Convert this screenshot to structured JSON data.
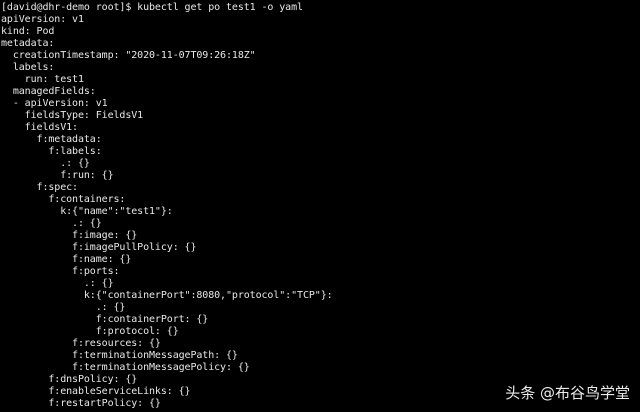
{
  "terminal": {
    "lines": [
      "[david@dhr-demo root]$ kubectl get po test1 -o yaml",
      "apiVersion: v1",
      "kind: Pod",
      "metadata:",
      "  creationTimestamp: \"2020-11-07T09:26:18Z\"",
      "  labels:",
      "    run: test1",
      "  managedFields:",
      "  - apiVersion: v1",
      "    fieldsType: FieldsV1",
      "    fieldsV1:",
      "      f:metadata:",
      "        f:labels:",
      "          .: {}",
      "          f:run: {}",
      "      f:spec:",
      "        f:containers:",
      "          k:{\"name\":\"test1\"}:",
      "            .: {}",
      "            f:image: {}",
      "            f:imagePullPolicy: {}",
      "            f:name: {}",
      "            f:ports:",
      "              .: {}",
      "              k:{\"containerPort\":8080,\"protocol\":\"TCP\"}:",
      "                .: {}",
      "                f:containerPort: {}",
      "                f:protocol: {}",
      "            f:resources: {}",
      "            f:terminationMessagePath: {}",
      "            f:terminationMessagePolicy: {}",
      "        f:dnsPolicy: {}",
      "        f:enableServiceLinks: {}",
      "        f:restartPolicy: {}"
    ]
  },
  "watermark": {
    "text": "头条 @布谷鸟学堂"
  }
}
